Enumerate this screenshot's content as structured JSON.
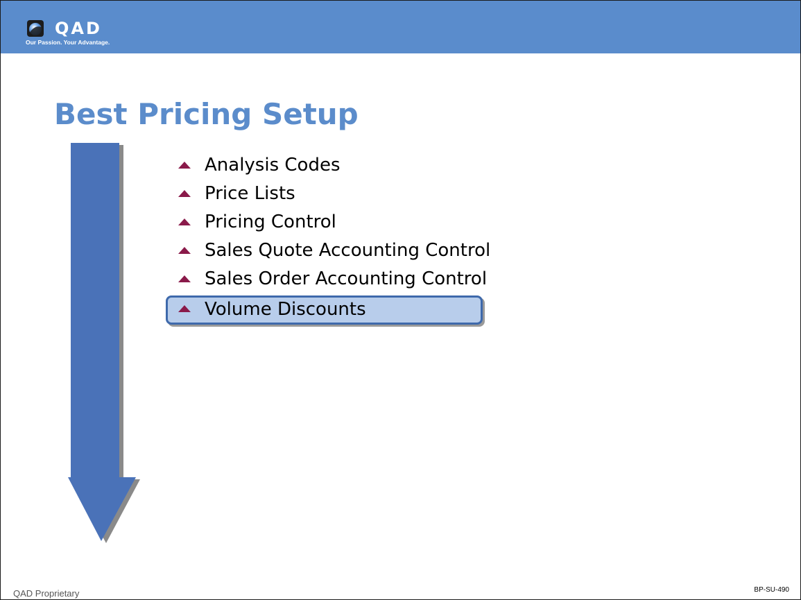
{
  "brand": {
    "logo_text": "QAD",
    "tagline": "Our Passion. Your Advantage.",
    "header_color": "#5a8ccc",
    "accent_color": "#5b8ccb",
    "bullet_color": "#8a1a4a",
    "highlight_fill": "#b8cdeb",
    "highlight_border": "#3e69ab"
  },
  "slide": {
    "title": "Best Pricing Setup",
    "items": [
      {
        "label": "Analysis Codes",
        "highlighted": false,
        "icon": "triangle-bullet-icon"
      },
      {
        "label": "Price Lists",
        "highlighted": false,
        "icon": "triangle-bullet-icon"
      },
      {
        "label": "Pricing Control",
        "highlighted": false,
        "icon": "triangle-bullet-icon"
      },
      {
        "label": "Sales Quote Accounting Control",
        "highlighted": false,
        "icon": "triangle-bullet-icon"
      },
      {
        "label": "Sales Order Accounting Control",
        "highlighted": false,
        "icon": "triangle-bullet-icon"
      },
      {
        "label": "Volume Discounts",
        "highlighted": true,
        "icon": "triangle-bullet-icon"
      }
    ],
    "progress_icon": "down-arrow-icon"
  },
  "footer": {
    "left": "QAD Proprietary",
    "right": "BP-SU-490"
  }
}
